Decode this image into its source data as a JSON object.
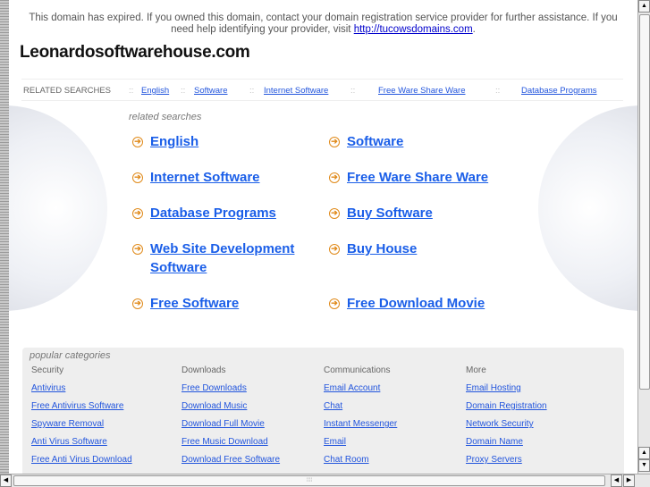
{
  "notice": {
    "text": "This domain has expired. If you owned this domain, contact your domain registration service provider for further assistance. If you need help identifying your provider, visit ",
    "link": "http://tucowsdomains.com",
    "end": "."
  },
  "site_title": "Leonardosoftwarehouse.com",
  "related_bar": {
    "label": "RELATED SEARCHES",
    "sep": "::",
    "links": [
      "English",
      "Software",
      "Internet Software",
      "Free Ware Share Ware",
      "Database Programs"
    ]
  },
  "related_searches": {
    "label": "related searches",
    "links": [
      "English",
      "Software",
      "Internet Software",
      "Free Ware Share Ware",
      "Database Programs",
      "Buy Software",
      "Web Site Development Software",
      "Buy House",
      "Free Software",
      "Free Download Movie"
    ]
  },
  "popular": {
    "label": "popular categories",
    "columns": [
      {
        "heading": "Security",
        "links": [
          "Antivirus",
          "Free Antivirus Software",
          "Spyware Removal",
          "Anti Virus Software",
          "Free Anti Virus Download"
        ]
      },
      {
        "heading": "Downloads",
        "links": [
          "Free Downloads",
          "Download Music",
          "Download Full Movie",
          "Free Music Download",
          "Download Free Software"
        ]
      },
      {
        "heading": "Communications",
        "links": [
          "Email Account",
          "Chat",
          "Instant Messenger",
          "Email",
          "Chat Room"
        ]
      },
      {
        "heading": "More",
        "links": [
          "Email Hosting",
          "Domain Registration",
          "Network Security",
          "Domain Name",
          "Proxy Servers"
        ]
      }
    ]
  },
  "colors": {
    "link": "#1a5ee8",
    "arrow": "#e08a1a"
  }
}
